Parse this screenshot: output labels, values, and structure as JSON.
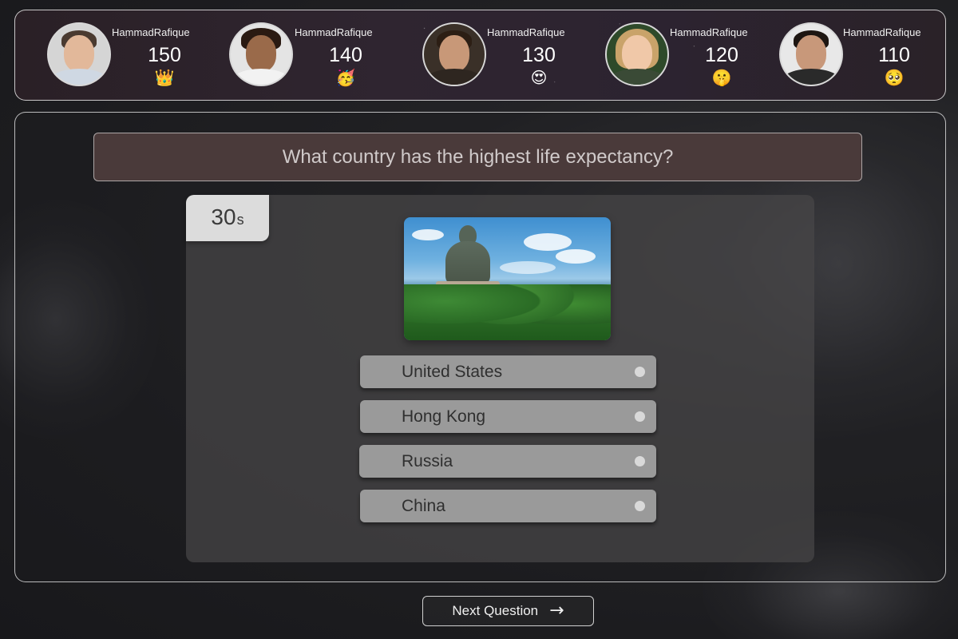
{
  "leaderboard": {
    "players": [
      {
        "name": "HammadRafique",
        "score": "150",
        "emoji": "👑",
        "emoji_name": "crown-icon"
      },
      {
        "name": "HammadRafique",
        "score": "140",
        "emoji": "🥳",
        "emoji_name": "party-face-icon"
      },
      {
        "name": "HammadRafique",
        "score": "130",
        "emoji": "😍",
        "emoji_name": "heart-eyes-icon"
      },
      {
        "name": "HammadRafique",
        "score": "120",
        "emoji": "🤫",
        "emoji_name": "shushing-face-icon"
      },
      {
        "name": "HammadRafique",
        "score": "110",
        "emoji": "🥺",
        "emoji_name": "pleading-face-icon"
      }
    ]
  },
  "question": {
    "text": "What country has the highest life expectancy?",
    "timer_value": "30",
    "timer_unit": "s",
    "options": [
      {
        "label": "United States"
      },
      {
        "label": "Hong Kong"
      },
      {
        "label": "Russia"
      },
      {
        "label": "China"
      }
    ]
  },
  "footer": {
    "next_label": "Next Question",
    "next_icon": "→"
  },
  "colors": {
    "question_bar_bg": "#4a3a3a",
    "option_bg": "#9a9a9a",
    "timer_bg": "#dcdcdc"
  }
}
